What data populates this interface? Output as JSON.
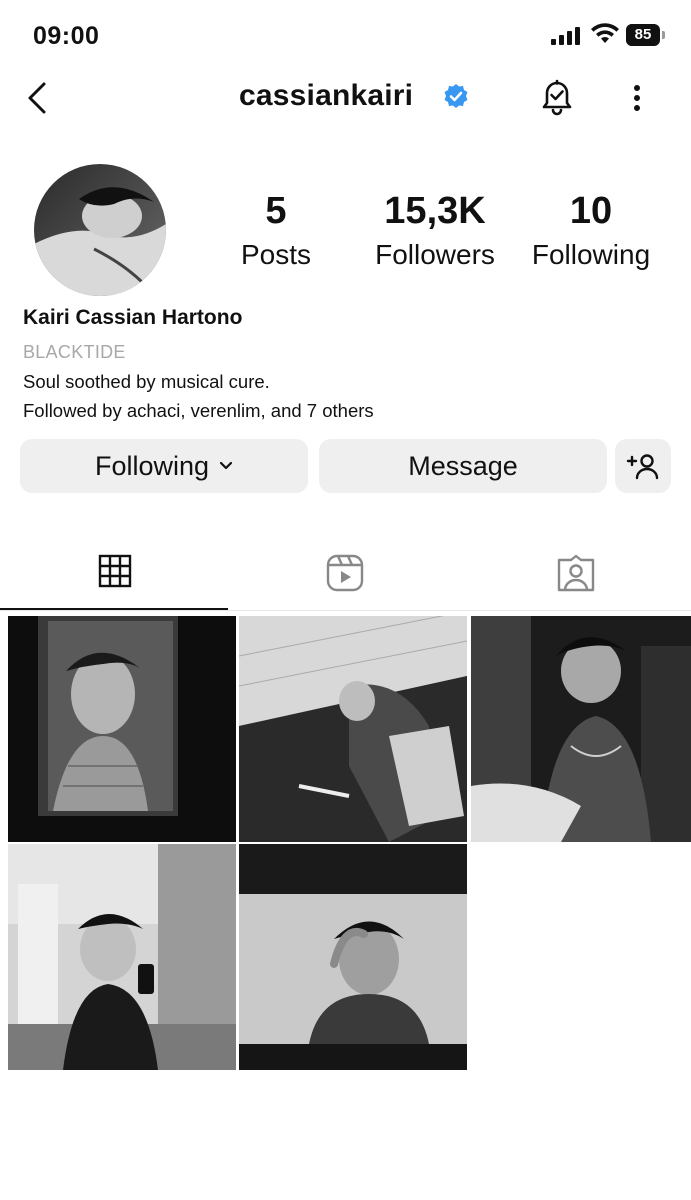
{
  "status_bar": {
    "time": "09:00",
    "battery": "85",
    "battery_level": 0.85,
    "icons": [
      "cellular-signal-icon",
      "wifi-icon",
      "battery-icon"
    ]
  },
  "header": {
    "username": "cassiankairi",
    "verified": true,
    "icons": [
      "back-arrow-icon",
      "verified-badge-icon",
      "notification-bell-icon",
      "more-options-icon"
    ]
  },
  "profile": {
    "stats": [
      {
        "value": "5",
        "label": "Posts"
      },
      {
        "value": "15,3K",
        "label": "Followers"
      },
      {
        "value": "10",
        "label": "Following"
      }
    ],
    "full_name": "Kairi Cassian Hartono",
    "category": "BLACKTIDE",
    "bio": "Soul soothed by musical cure.",
    "followed_by": "Followed by achaci, verenlim, and 7 others"
  },
  "actions": {
    "following_label": "Following",
    "message_label": "Message",
    "add_icon": "add-person-icon"
  },
  "tabs": [
    {
      "icon": "grid-icon",
      "active": true
    },
    {
      "icon": "reels-icon",
      "active": false
    },
    {
      "icon": "tagged-icon",
      "active": false
    }
  ],
  "colors": {
    "verified": "#3897f0",
    "button_bg": "#efefef",
    "category_text": "#a8a8a8"
  }
}
